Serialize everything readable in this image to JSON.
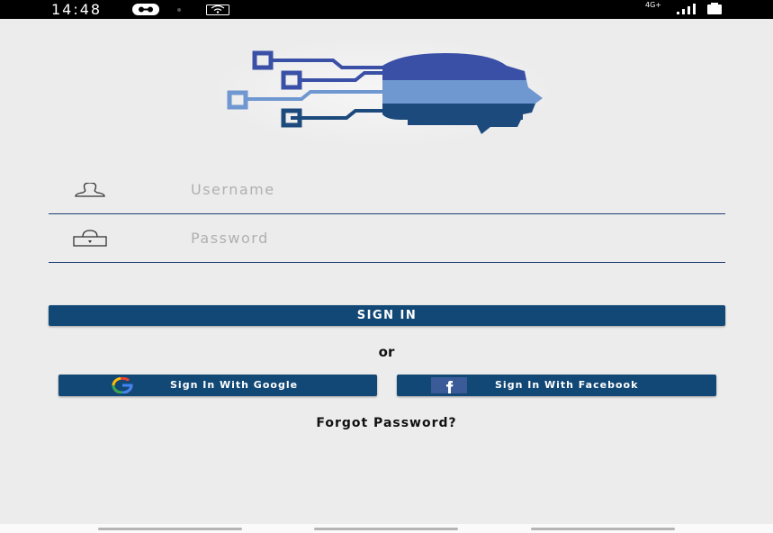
{
  "status_bar": {
    "time": "14:48",
    "network_label": "4G+",
    "icons": [
      "status-app-icon",
      "notification-dot-icon",
      "wifi-icon",
      "signal-icon",
      "battery-icon"
    ]
  },
  "logo": {
    "icon": "ai-head-circuit-logo"
  },
  "form": {
    "username_placeholder": "Username",
    "password_placeholder": "Password",
    "username_icon": "user-icon",
    "password_icon": "lock-icon"
  },
  "buttons": {
    "sign_in": "SIGN IN",
    "or": "or",
    "google": "Sign In With Google",
    "facebook": "Sign In With Facebook",
    "forgot": "Forgot Password?"
  },
  "colors": {
    "primary": "#124876",
    "background": "#ececec",
    "logo_dark": "#1d4a7c",
    "logo_mid": "#3a4fa6",
    "logo_light": "#6f97d0"
  }
}
